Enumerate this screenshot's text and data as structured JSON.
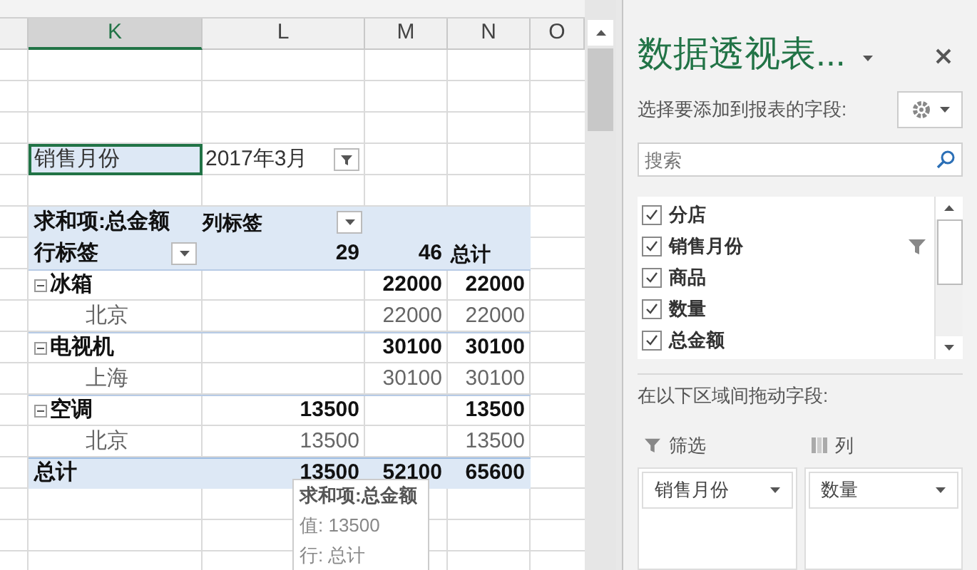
{
  "sheet": {
    "columns": [
      {
        "label": "K",
        "selected": true
      },
      {
        "label": "L",
        "selected": false
      },
      {
        "label": "M",
        "selected": false
      },
      {
        "label": "N",
        "selected": false
      },
      {
        "label": "O",
        "selected": false
      }
    ],
    "rows": [
      {
        "kind": "blank"
      },
      {
        "kind": "blank"
      },
      {
        "kind": "blank"
      },
      {
        "kind": "filter",
        "field": "销售月份",
        "value": "2017年3月",
        "field_selected": true
      },
      {
        "kind": "blank"
      },
      {
        "kind": "value_header",
        "label": "求和项:总金额",
        "column_label": "列标签"
      },
      {
        "kind": "column_header",
        "label": "行标签",
        "values": {
          "l": "29",
          "m": "46",
          "n": "总计"
        }
      },
      {
        "kind": "group",
        "label": "冰箱",
        "expanded": true,
        "values": {
          "m": "22000",
          "n": "22000"
        }
      },
      {
        "kind": "item",
        "label": "北京",
        "values": {
          "m": "22000",
          "n": "22000"
        }
      },
      {
        "kind": "group",
        "label": "电视机",
        "expanded": true,
        "values": {
          "m": "30100",
          "n": "30100"
        }
      },
      {
        "kind": "item",
        "label": "上海",
        "values": {
          "m": "30100",
          "n": "30100"
        }
      },
      {
        "kind": "group",
        "label": "空调",
        "expanded": true,
        "values": {
          "l": "13500",
          "n": "13500"
        }
      },
      {
        "kind": "item",
        "label": "北京",
        "values": {
          "l": "13500",
          "n": "13500"
        }
      },
      {
        "kind": "total",
        "label": "总计",
        "values": {
          "l": "13500",
          "m": "52100",
          "n": "65600"
        }
      },
      {
        "kind": "blank"
      },
      {
        "kind": "blank"
      },
      {
        "kind": "blank"
      }
    ],
    "tooltip": {
      "title": "求和项:总金额",
      "lines": [
        "值: 13500",
        "行: 总计"
      ]
    }
  },
  "panel": {
    "title": "数据透视表...",
    "subtitle": "选择要添加到报表的字段:",
    "search": {
      "placeholder": "搜索"
    },
    "fields": [
      {
        "label": "分店",
        "checked": true,
        "filtered": false
      },
      {
        "label": "销售月份",
        "checked": true,
        "filtered": true
      },
      {
        "label": "商品",
        "checked": true,
        "filtered": false
      },
      {
        "label": "数量",
        "checked": true,
        "filtered": false
      },
      {
        "label": "总金额",
        "checked": true,
        "filtered": false
      }
    ],
    "areas_label": "在以下区域间拖动字段:",
    "areas": [
      {
        "kind": "filter",
        "title": "筛选",
        "items": [
          "销售月份"
        ]
      },
      {
        "kind": "columns",
        "title": "列",
        "items": [
          "数量"
        ]
      }
    ]
  }
}
